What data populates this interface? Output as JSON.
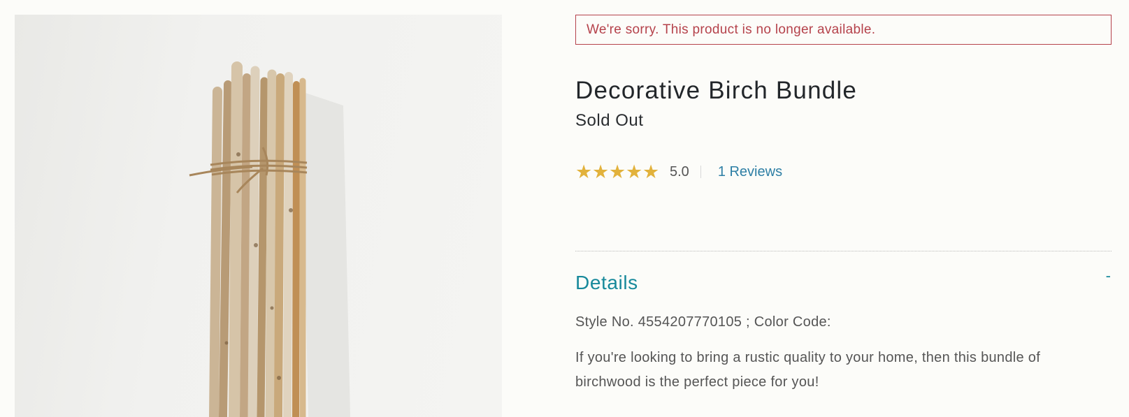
{
  "product": {
    "unavailable_message": "We're sorry. This product is no longer available.",
    "name": "Decorative Birch Bundle",
    "status": "Sold Out",
    "rating": {
      "stars": 5,
      "value": "5.0",
      "reviews_link": "1 Reviews"
    },
    "details": {
      "heading": "Details",
      "toggle": "-",
      "style_line": "Style No. 4554207770105 ; Color Code:",
      "description": "If you're looking to bring a rustic quality to your home, then this bundle of birchwood is the perfect piece for you!"
    }
  },
  "colors": {
    "alert": "#b5424b",
    "accent": "#17899b",
    "link": "#2e7fa5",
    "star": "#e2b23c"
  }
}
